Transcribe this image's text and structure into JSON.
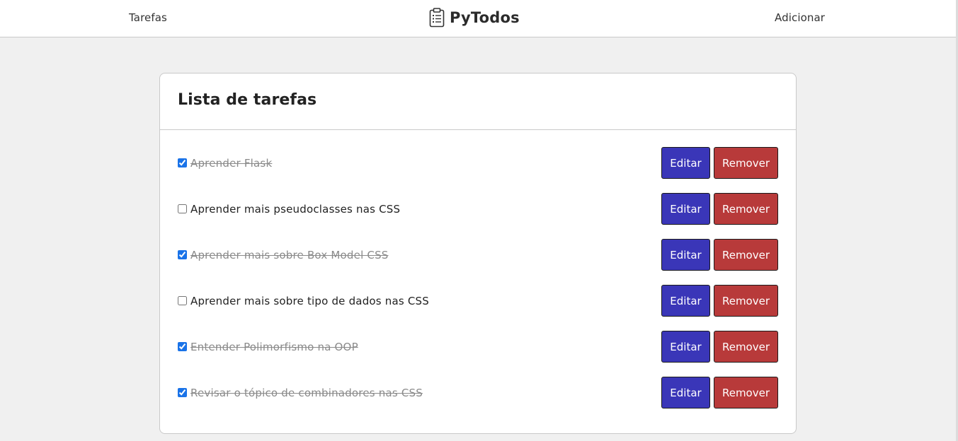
{
  "nav": {
    "tasks_link": "Tarefas",
    "add_link": "Adicionar",
    "brand": "PyTodos",
    "brand_icon": "clipboard-icon"
  },
  "card": {
    "title": "Lista de tarefas"
  },
  "tasks": [
    {
      "text": "Aprender Flask",
      "done": true
    },
    {
      "text": "Aprender mais pseudoclasses nas CSS",
      "done": false
    },
    {
      "text": "Aprender mais sobre Box Model CSS",
      "done": true
    },
    {
      "text": "Aprender mais sobre tipo de dados nas CSS",
      "done": false
    },
    {
      "text": "Entender Polimorfismo na OOP",
      "done": true
    },
    {
      "text": "Revisar o tópico de combinadores nas CSS",
      "done": true
    }
  ],
  "buttons": {
    "edit": "Editar",
    "remove": "Remover"
  },
  "colors": {
    "edit_button": "#3a36b8",
    "remove_button": "#b83a3a",
    "page_background": "#f0f0f0"
  }
}
